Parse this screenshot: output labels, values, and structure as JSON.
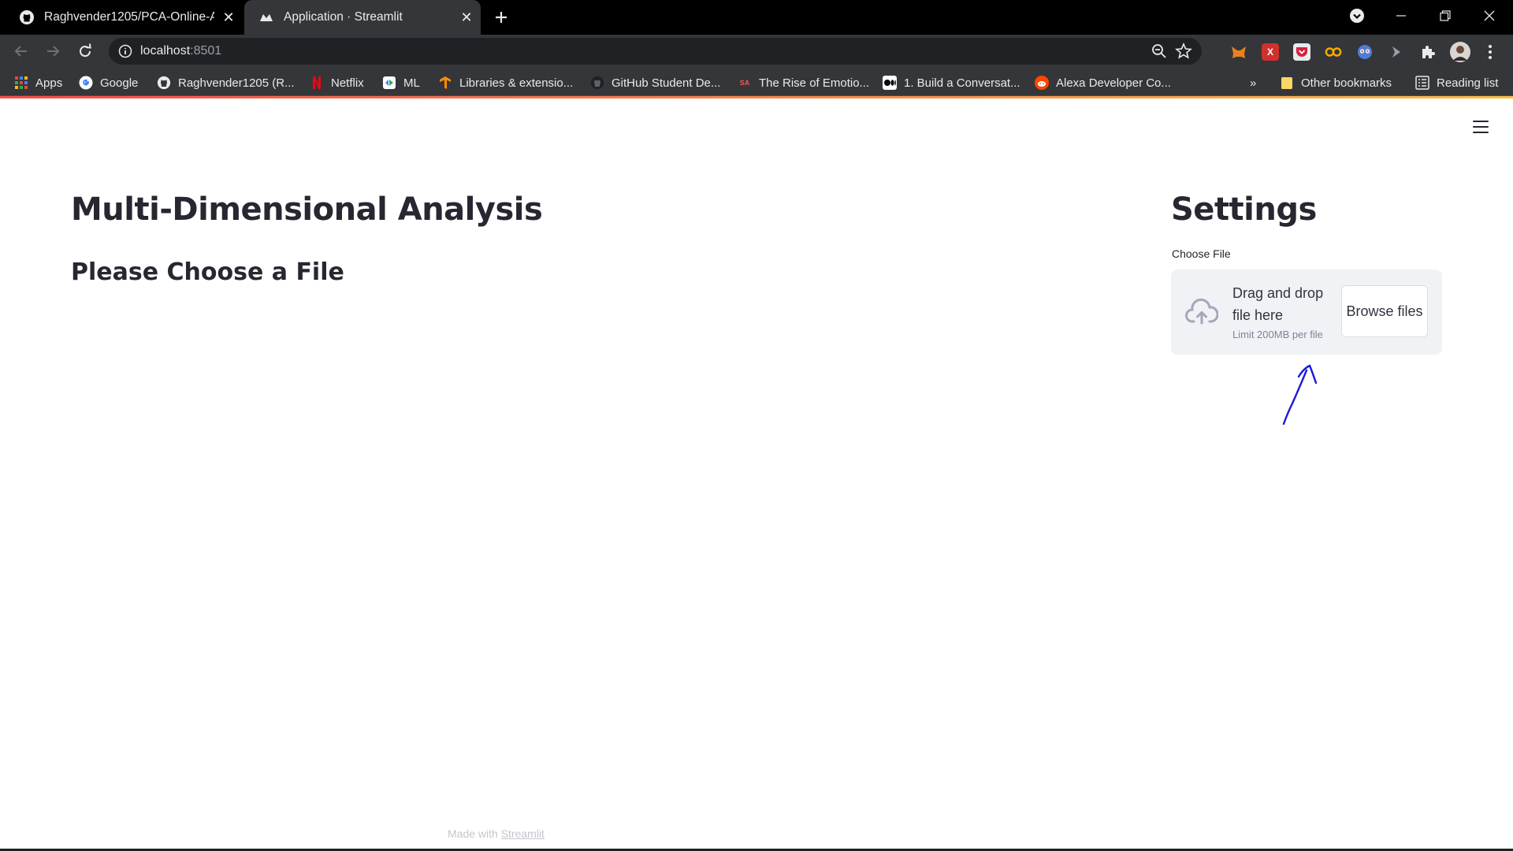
{
  "browser": {
    "tabs": [
      {
        "title": "Raghvender1205/PCA-Online-Ap",
        "favicon": "github-icon",
        "active": false
      },
      {
        "title": "Application · Streamlit",
        "favicon": "streamlit-icon",
        "active": true
      }
    ],
    "address": {
      "host": "localhost",
      "port": ":8501"
    },
    "bookmarks": [
      {
        "label": "Apps",
        "icon": "apps-grid-icon"
      },
      {
        "label": "Google",
        "icon": "google-icon"
      },
      {
        "label": "Raghvender1205 (R...",
        "icon": "github-icon"
      },
      {
        "label": "Netflix",
        "icon": "netflix-icon"
      },
      {
        "label": "ML",
        "icon": "ml-icon"
      },
      {
        "label": "Libraries & extensio...",
        "icon": "tensorflow-icon"
      },
      {
        "label": "GitHub Student De...",
        "icon": "github-icon"
      },
      {
        "label": "The Rise of Emotio...",
        "icon": "sa-icon"
      },
      {
        "label": "1. Build a Conversat...",
        "icon": "medium-icon"
      },
      {
        "label": "Alexa Developer Co...",
        "icon": "reddit-icon"
      }
    ],
    "bookmarks_overflow": "»",
    "other_bookmarks": "Other bookmarks",
    "reading_list": "Reading list"
  },
  "app": {
    "title": "Multi-Dimensional Analysis",
    "subtitle": "Please Choose a File",
    "sidebar": {
      "title": "Settings",
      "uploader": {
        "label": "Choose File",
        "drag_text": "Drag and drop file here",
        "limit_text": "Limit 200MB per file",
        "browse_label": "Browse files"
      }
    },
    "footer": {
      "prefix": "Made with ",
      "link": "Streamlit"
    }
  },
  "colors": {
    "text": "#262730",
    "uploader_bg": "#f0f2f6",
    "annotation": "#1a1ad6",
    "chrome_dark": "#35363a"
  }
}
